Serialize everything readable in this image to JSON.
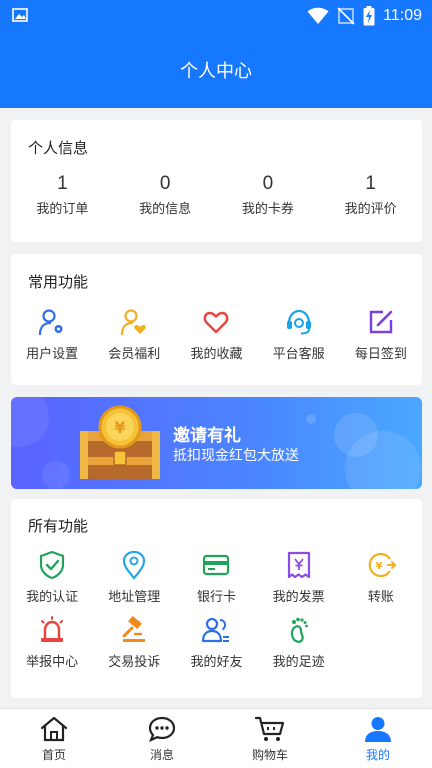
{
  "status_bar": {
    "time": "11:09"
  },
  "header": {
    "title": "个人中心"
  },
  "personal_info": {
    "title": "个人信息",
    "stats": [
      {
        "value": "1",
        "label": "我的订单"
      },
      {
        "value": "0",
        "label": "我的信息"
      },
      {
        "value": "0",
        "label": "我的卡券"
      },
      {
        "value": "1",
        "label": "我的评价"
      }
    ]
  },
  "common_functions": {
    "title": "常用功能",
    "items": [
      {
        "label": "用户设置",
        "icon": "user-settings-icon"
      },
      {
        "label": "会员福利",
        "icon": "member-benefit-icon"
      },
      {
        "label": "我的收藏",
        "icon": "heart-icon"
      },
      {
        "label": "平台客服",
        "icon": "headset-icon"
      },
      {
        "label": "每日签到",
        "icon": "edit-checkin-icon"
      }
    ]
  },
  "banner": {
    "title": "邀请有礼",
    "subtitle": "抵扣现金红包大放送"
  },
  "all_functions": {
    "title": "所有功能",
    "items": [
      {
        "label": "我的认证",
        "icon": "shield-check-icon"
      },
      {
        "label": "地址管理",
        "icon": "location-pin-icon"
      },
      {
        "label": "银行卡",
        "icon": "bank-card-icon"
      },
      {
        "label": "我的发票",
        "icon": "invoice-icon"
      },
      {
        "label": "转账",
        "icon": "transfer-icon"
      },
      {
        "label": "举报中心",
        "icon": "alarm-icon"
      },
      {
        "label": "交易投诉",
        "icon": "gavel-icon"
      },
      {
        "label": "我的好友",
        "icon": "friends-icon"
      },
      {
        "label": "我的足迹",
        "icon": "footprint-icon"
      }
    ]
  },
  "tabbar": {
    "tabs": [
      {
        "label": "首页",
        "icon": "home-icon"
      },
      {
        "label": "消息",
        "icon": "message-icon"
      },
      {
        "label": "购物车",
        "icon": "cart-icon"
      },
      {
        "label": "我的",
        "icon": "profile-icon"
      }
    ],
    "active": "我的"
  },
  "colors": {
    "primary": "#1677ff",
    "background": "#f1f2f4"
  }
}
